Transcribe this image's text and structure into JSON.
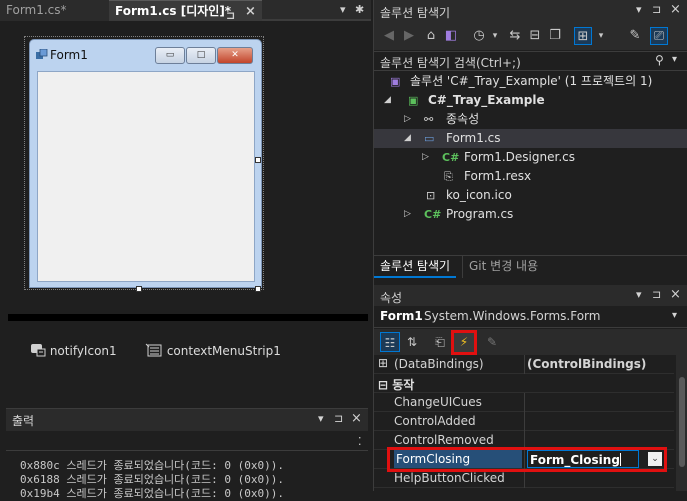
{
  "editor": {
    "tabs": [
      {
        "label": "Form1.cs*"
      },
      {
        "label": "Form1.cs [디자인]*"
      }
    ],
    "pin_glyph": "⊐",
    "close_glyph": "×",
    "overflow_glyph": "▾",
    "settings_glyph": "✱"
  },
  "designer": {
    "form_title": "Form1",
    "min_glyph": "▭",
    "max_glyph": "□",
    "close_glyph": "✕",
    "tray_items": [
      {
        "label": "notifyIcon1",
        "icon": "notify-icon"
      },
      {
        "label": "contextMenuStrip1",
        "icon": "context-menu-icon"
      }
    ]
  },
  "output": {
    "title": "출력",
    "lines": [
      "0x880c 스레드가 종료되었습니다(코드: 0 (0x0)).",
      "0x6188 스레드가 종료되었습니다(코드: 0 (0x0)).",
      "0x19b4 스레드가 종료되었습니다(코드: 0 (0x0))."
    ]
  },
  "solution_explorer": {
    "title": "솔루션 탐색기",
    "search_placeholder": "솔루션 탐색기 검색(Ctrl+;)",
    "tree": [
      {
        "label": "솔루션 'C#_Tray_Example' (1 프로젝트의 1)",
        "level": 0,
        "icon": "solution-icon",
        "expander": ""
      },
      {
        "label": "C#_Tray_Example",
        "level": 1,
        "icon": "csharp-project-icon",
        "expander": "◢",
        "bold": true
      },
      {
        "label": "종속성",
        "level": 2,
        "icon": "dependencies-icon",
        "expander": "▷"
      },
      {
        "label": "Form1.cs",
        "level": 2,
        "icon": "form-icon",
        "expander": "◢",
        "selected": true
      },
      {
        "label": "Form1.Designer.cs",
        "level": 3,
        "icon": "csharp-file-icon",
        "expander": "▷"
      },
      {
        "label": "Form1.resx",
        "level": 3,
        "icon": "resource-file-icon",
        "expander": ""
      },
      {
        "label": "ko_icon.ico",
        "level": 2,
        "icon": "ico-file-icon",
        "expander": ""
      },
      {
        "label": "Program.cs",
        "level": 2,
        "icon": "csharp-file-icon",
        "expander": "▷"
      }
    ],
    "bottom_tabs": [
      {
        "label": "솔루션 탐색기"
      },
      {
        "label": "Git 변경 내용"
      }
    ]
  },
  "properties": {
    "title": "속성",
    "object_name": "Form1",
    "object_type": "System.Windows.Forms.Form",
    "rows": [
      {
        "kind": "prop",
        "name": "(DataBindings)",
        "value": "(ControlBindings)",
        "expander": "⊞",
        "bold_value": true
      },
      {
        "kind": "cat",
        "name": "동작",
        "expander": "⊟"
      },
      {
        "kind": "prop",
        "name": "ChangeUICues",
        "value": ""
      },
      {
        "kind": "prop",
        "name": "ControlAdded",
        "value": ""
      },
      {
        "kind": "prop",
        "name": "ControlRemoved",
        "value": ""
      },
      {
        "kind": "prop",
        "name": "FormClosing",
        "value": "Form_Closing",
        "selected": true
      },
      {
        "kind": "prop",
        "name": "HelpButtonClicked",
        "value": ""
      }
    ]
  },
  "colors": {
    "accent": "#0078d4",
    "highlight_box": "#e01010",
    "csharp_green": "#5cc05c",
    "selected_row": "#264f78"
  }
}
